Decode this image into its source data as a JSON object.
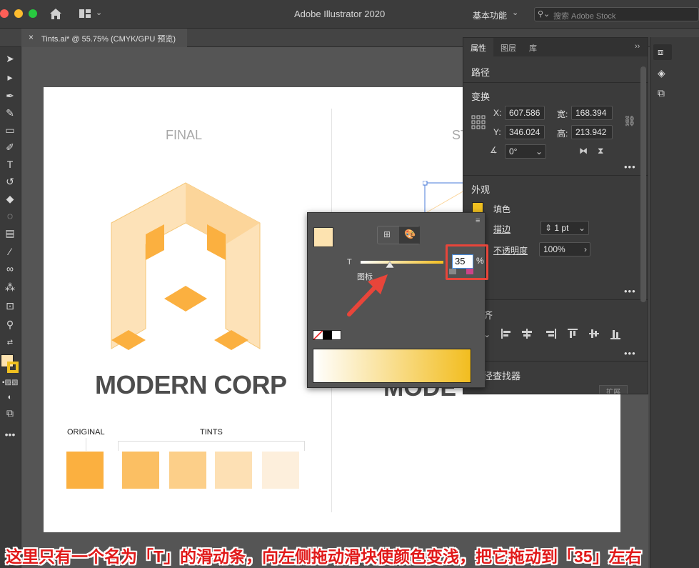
{
  "window": {
    "title": "Adobe Illustrator 2020",
    "workspace": "基本功能",
    "search_placeholder": "搜索 Adobe Stock"
  },
  "document_tab": {
    "close": "×",
    "title": "Tints.ai* @ 55.75% (CMYK/GPU 预览)"
  },
  "artboard": {
    "final_label": "FINAL",
    "partial_label": "ST",
    "company": "MODERN CORP",
    "company_partial": "MODE",
    "original_label": "ORIGINAL",
    "tints_label": "TINTS",
    "swatches": {
      "original": "#fbb040",
      "tints": [
        "#fbbf63",
        "#fccf89",
        "#fde0b4",
        "#fdefdc"
      ]
    }
  },
  "properties_panel": {
    "tabs": [
      "属性",
      "图层",
      "库"
    ],
    "collapse": "››",
    "section_path": "路径",
    "section_transform": "变换",
    "x_label": "X:",
    "x_value": "607.586",
    "y_label": "Y:",
    "y_value": "346.024",
    "w_label": "宽:",
    "w_value": "168.394",
    "h_label": "高:",
    "h_value": "213.942",
    "angle_value": "0°",
    "section_appearance": "外观",
    "fill_label": "填色",
    "stroke_label": "描边",
    "stroke_value": "1 pt",
    "opacity_label": "不透明度",
    "opacity_value": "100%",
    "align_partial": "齐",
    "pathfinder_partial": "径查找器",
    "more": "•••",
    "expand_partial": "扩展"
  },
  "color_panel": {
    "slider_label": "T",
    "tint_value": "35",
    "percent": "%",
    "tooltip": "图标",
    "fill_color": "#fde3b0",
    "ramp_start": "#ffffff",
    "ramp_end": "#f2bd1f"
  },
  "caption": {
    "text": "这里只有一个名为「T」的滑动条，向左侧拖动滑块使颜色变浅，把它拖动到「35」左右"
  }
}
